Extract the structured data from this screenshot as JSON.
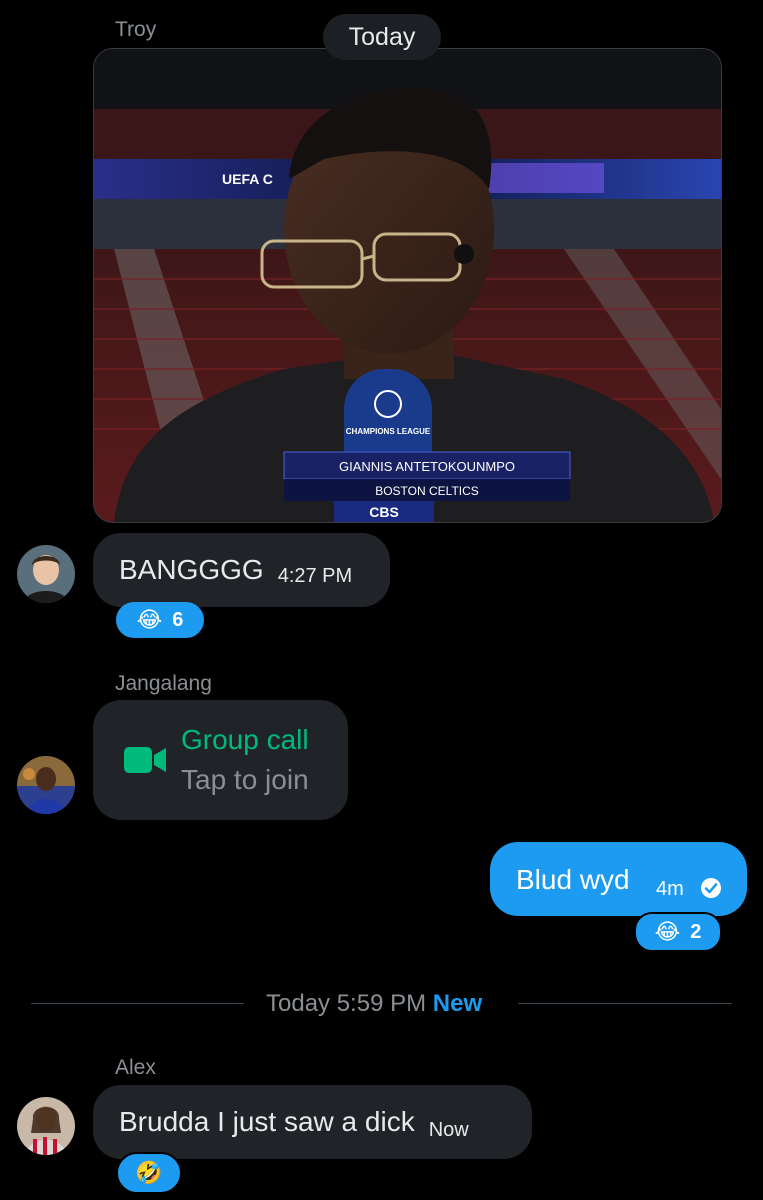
{
  "header_date": "Today",
  "messages": [
    {
      "sender": "Troy",
      "type": "image",
      "image": {
        "banner": "UEFA C",
        "mic_text": "CHAMPIONS LEAGUE",
        "lower_third_name": "GIANNIS ANTETOKOUNMPO",
        "lower_third_team": "BOSTON CELTICS",
        "network": "CBS"
      },
      "text": "BANGGGG",
      "time": "4:27 PM",
      "reaction": {
        "emoji": "😂",
        "count": "6"
      }
    },
    {
      "sender": "Jangalang",
      "type": "call",
      "call_title": "Group call",
      "call_subtitle": "Tap to join",
      "icon": "video-camera-icon"
    },
    {
      "sender": "me",
      "text": "Blud wyd",
      "time": "4m",
      "status_icon": "check-circle-icon",
      "reaction": {
        "emoji": "😂",
        "count": "2"
      }
    }
  ],
  "divider": {
    "label": "Today 5:59 PM",
    "badge": "New"
  },
  "new_messages": [
    {
      "sender": "Alex",
      "text": "Brudda I just saw a dick",
      "time": "Now",
      "reaction": {
        "emoji": "🤣"
      }
    }
  ],
  "colors": {
    "background": "#000000",
    "bubble_in": "#202327",
    "bubble_out": "#1d9bf0",
    "call_green": "#00ba7c",
    "muted": "#8b8f94"
  }
}
